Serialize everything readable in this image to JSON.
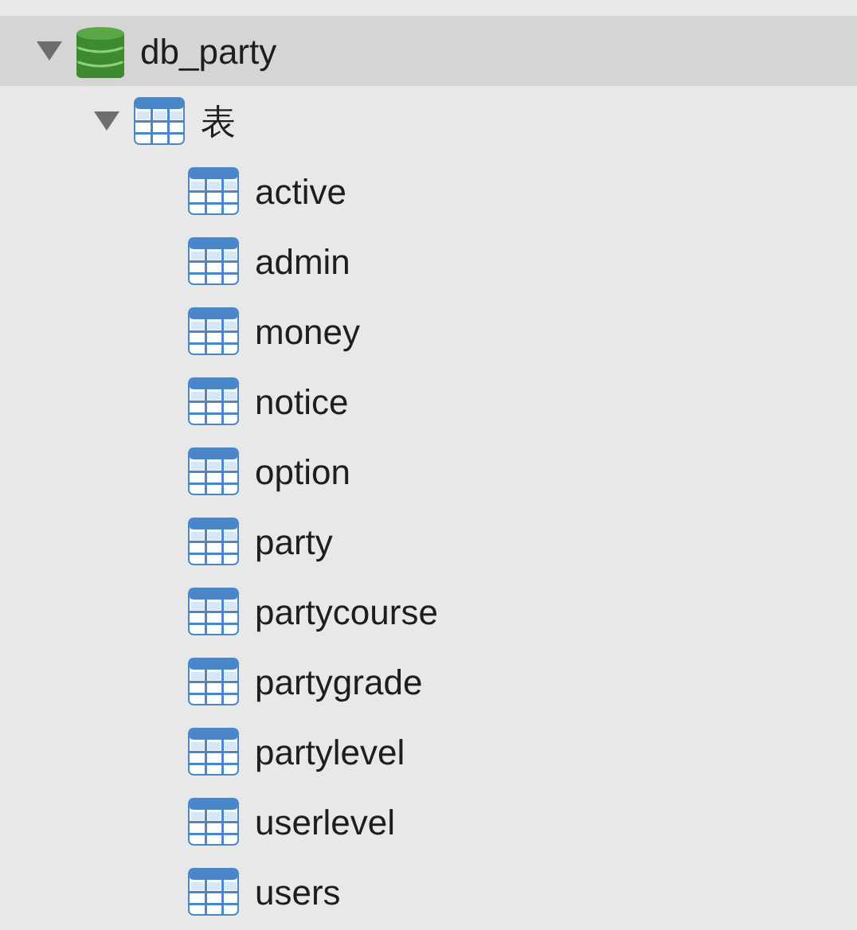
{
  "tree": [
    {
      "label": "db_party",
      "kind": "database",
      "expanded": true,
      "selected": true,
      "children": [
        {
          "label": "表",
          "kind": "folder",
          "expanded": true,
          "selected": false,
          "children": [
            {
              "label": "active",
              "kind": "table",
              "selected": false
            },
            {
              "label": "admin",
              "kind": "table",
              "selected": false
            },
            {
              "label": "money",
              "kind": "table",
              "selected": false
            },
            {
              "label": "notice",
              "kind": "table",
              "selected": false
            },
            {
              "label": "option",
              "kind": "table",
              "selected": false
            },
            {
              "label": "party",
              "kind": "table",
              "selected": false
            },
            {
              "label": "partycourse",
              "kind": "table",
              "selected": false
            },
            {
              "label": "partygrade",
              "kind": "table",
              "selected": false
            },
            {
              "label": "partylevel",
              "kind": "table",
              "selected": false
            },
            {
              "label": "userlevel",
              "kind": "table",
              "selected": false
            },
            {
              "label": "users",
              "kind": "table",
              "selected": false
            }
          ]
        }
      ]
    }
  ]
}
